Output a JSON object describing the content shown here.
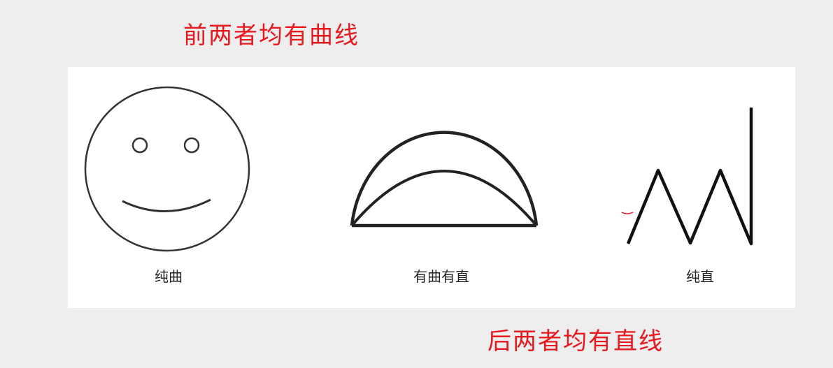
{
  "annotations": {
    "top": "前两者均有曲线",
    "bottom": "后两者均有直线",
    "color": "#e8191e"
  },
  "figures": [
    {
      "caption": "纯曲",
      "icon": "smiley-face-icon"
    },
    {
      "caption": "有曲有直",
      "icon": "half-moon-shape-icon"
    },
    {
      "caption": "纯直",
      "icon": "zigzag-lines-icon"
    }
  ],
  "colors": {
    "background": "#eeeeee",
    "panel": "#ffffff",
    "stroke": "#222222"
  }
}
